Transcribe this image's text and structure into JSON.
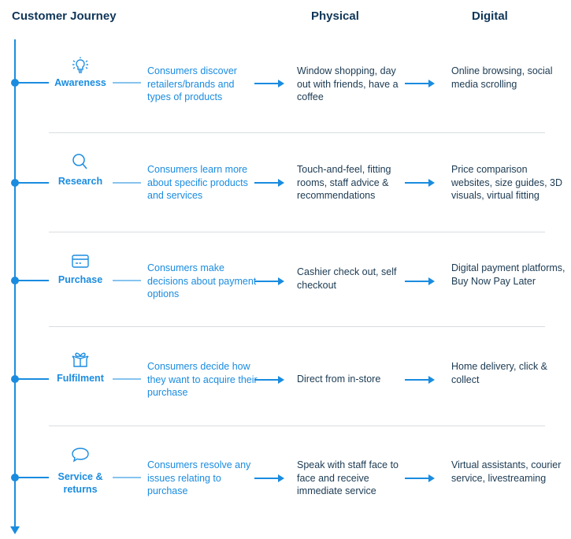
{
  "headers": {
    "journey": "Customer Journey",
    "physical": "Physical",
    "digital": "Digital"
  },
  "colors": {
    "accent": "#1a8ce0",
    "heading": "#0f3658",
    "body_text": "#1b3a52",
    "divider": "#d9dde0"
  },
  "stages": [
    {
      "icon": "lightbulb-icon",
      "label": "Awareness",
      "description": "Consumers discover retailers/brands and types of products",
      "physical": "Window shopping, day out with friends, have a coffee",
      "digital": "Online browsing, social media scrolling"
    },
    {
      "icon": "search-icon",
      "label": "Research",
      "description": "Consumers learn more about specific products and services",
      "physical": "Touch-and-feel, fitting rooms, staff advice & recommendations",
      "digital": "Price comparison websites, size guides, 3D visuals, virtual fitting"
    },
    {
      "icon": "credit-card-icon",
      "label": "Purchase",
      "description": "Consumers make decisions about payment options",
      "physical": "Cashier check out, self checkout",
      "digital": "Digital payment platforms, Buy Now Pay Later"
    },
    {
      "icon": "gift-box-icon",
      "label": "Fulfilment",
      "description": "Consumers decide how they want to acquire their purchase",
      "physical": "Direct from in-store",
      "digital": "Home delivery, click & collect"
    },
    {
      "icon": "speech-bubble-icon",
      "label": "Service & returns",
      "description": "Consumers resolve any issues relating to purchase",
      "physical": "Speak with staff face to face and receive immediate service",
      "digital": "Virtual assistants, courier service, livestreaming"
    }
  ]
}
